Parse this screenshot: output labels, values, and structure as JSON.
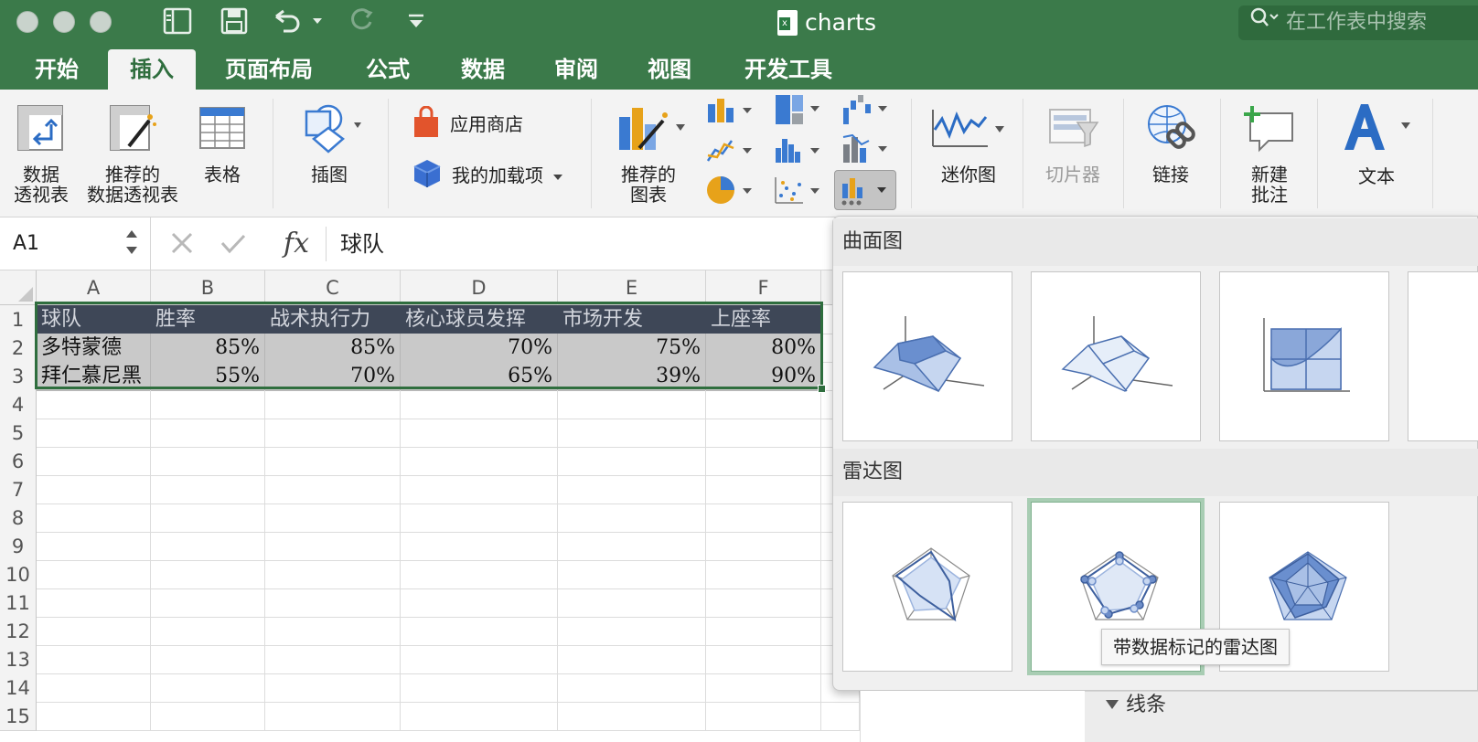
{
  "window": {
    "title": "charts",
    "search_placeholder": "在工作表中搜索"
  },
  "tabs": [
    {
      "label": "开始"
    },
    {
      "label": "插入",
      "active": true
    },
    {
      "label": "页面布局"
    },
    {
      "label": "公式"
    },
    {
      "label": "数据"
    },
    {
      "label": "审阅"
    },
    {
      "label": "视图"
    },
    {
      "label": "开发工具"
    }
  ],
  "ribbon": {
    "pivot": {
      "line1": "数据",
      "line2": "透视表"
    },
    "recommended_pivot": {
      "line1": "推荐的",
      "line2": "数据透视表"
    },
    "table": "表格",
    "illustrations": "插图",
    "app_store": "应用商店",
    "my_addins": "我的加载项",
    "recommended_charts": {
      "line1": "推荐的",
      "line2": "图表"
    },
    "sparklines": "迷你图",
    "slicer": "切片器",
    "link": "链接",
    "new_comment": {
      "line1": "新建",
      "line2": "批注"
    },
    "text": "文本"
  },
  "formula_bar": {
    "name_box": "A1",
    "formula": "球队",
    "fx": "fx"
  },
  "columns": [
    "A",
    "B",
    "C",
    "D",
    "E",
    "F"
  ],
  "rows": [
    "1",
    "2",
    "3",
    "4",
    "5",
    "6",
    "7",
    "8",
    "9",
    "10",
    "11",
    "12",
    "13",
    "14",
    "15"
  ],
  "sheet": {
    "header": [
      "球队",
      "胜率",
      "战术执行力",
      "核心球员发挥",
      "市场开发",
      "上座率"
    ],
    "data": [
      [
        "多特蒙德",
        "85%",
        "85%",
        "70%",
        "75%",
        "80%"
      ],
      [
        "拜仁慕尼黑",
        "55%",
        "70%",
        "65%",
        "39%",
        "90%"
      ]
    ]
  },
  "chart_panel": {
    "surface_section": "曲面图",
    "radar_section": "雷达图",
    "tooltip": "带数据标记的雷达图"
  },
  "behind_panel_label": "线条",
  "colors": {
    "accent": "#3b7a4a",
    "header_fill": "#3e4757",
    "data_fill": "#c9c9c9",
    "chart_blue": "#5b7fbf"
  }
}
